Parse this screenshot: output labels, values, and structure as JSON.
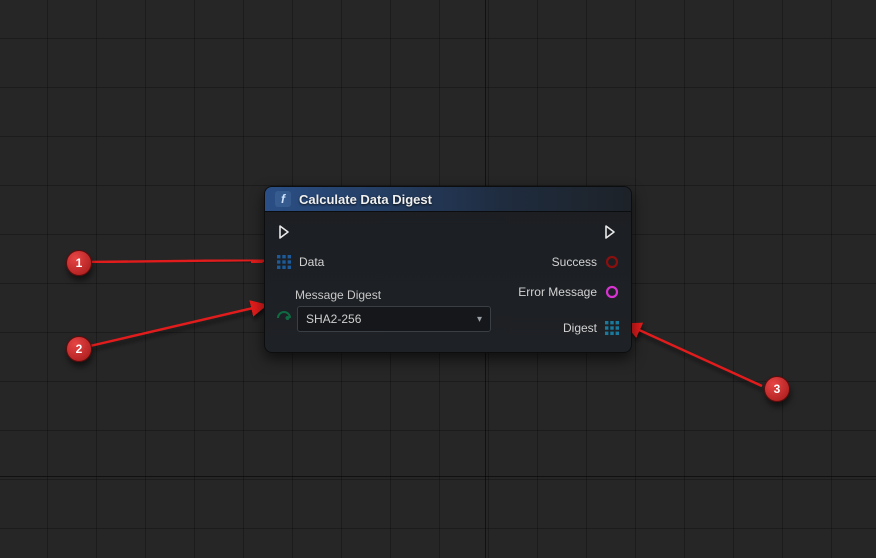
{
  "node": {
    "title": "Calculate Data Digest",
    "badge_glyph": "f",
    "inputs": {
      "exec": "",
      "data_label": "Data",
      "data_pin_color": "#163d6b",
      "message_digest_label": "Message Digest",
      "message_digest_pin_color": "#0b5b3a",
      "message_digest_value": "SHA2-256"
    },
    "outputs": {
      "exec": "",
      "success_label": "Success",
      "success_pin_color": "#8a0f0f",
      "error_label": "Error Message",
      "error_pin_color": "#d733d1",
      "digest_label": "Digest",
      "digest_pin_color": "#1a7a9e"
    }
  },
  "callouts": {
    "c1": "1",
    "c2": "2",
    "c3": "3"
  }
}
